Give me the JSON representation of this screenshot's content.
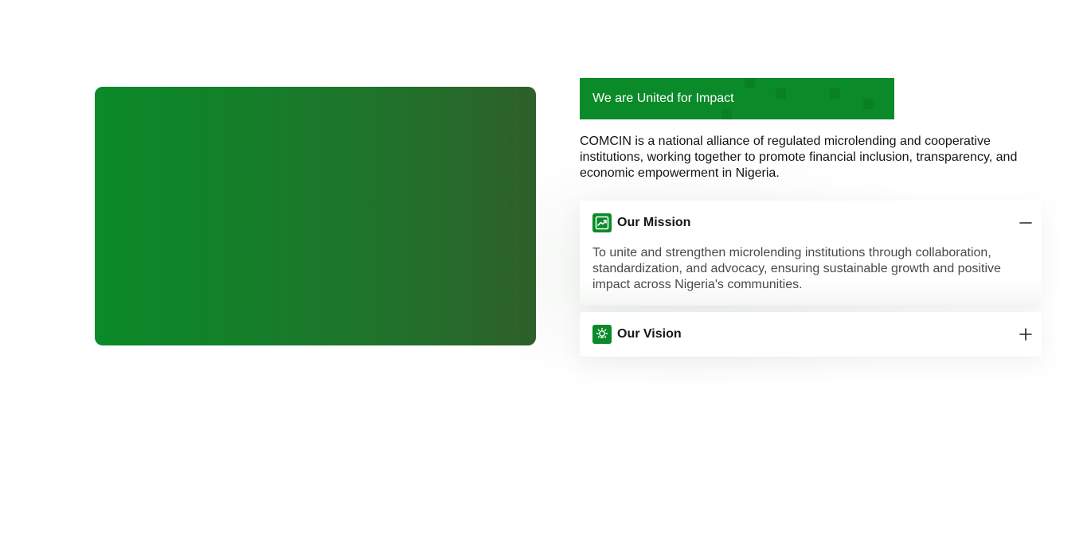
{
  "hero": {
    "image_color_start": "#0a8a28",
    "image_color_end": "#2f5f2a"
  },
  "tag": {
    "label": "We are United for Impact",
    "color": "#0a8a28"
  },
  "intro": {
    "text": "COMCIN is a national alliance of regulated microlending and cooperative institutions, working together to promote financial inclusion, transparency, and economic empowerment in Nigeria."
  },
  "accordion": {
    "items": [
      {
        "icon": "chart-trend-icon",
        "title": "Our Mission",
        "toggle_icon": "minus-icon",
        "expanded": true,
        "body": "To unite and strengthen microlending institutions through collaboration, standardization, and advocacy, ensuring sustainable growth and positive impact across Nigeria's communities."
      },
      {
        "icon": "lightbulb-icon",
        "title": "Our Vision",
        "toggle_icon": "plus-icon",
        "expanded": false
      }
    ]
  },
  "colors": {
    "accent": "#0a8a28",
    "text": "#141414",
    "muted_text": "#4a4a4a"
  }
}
